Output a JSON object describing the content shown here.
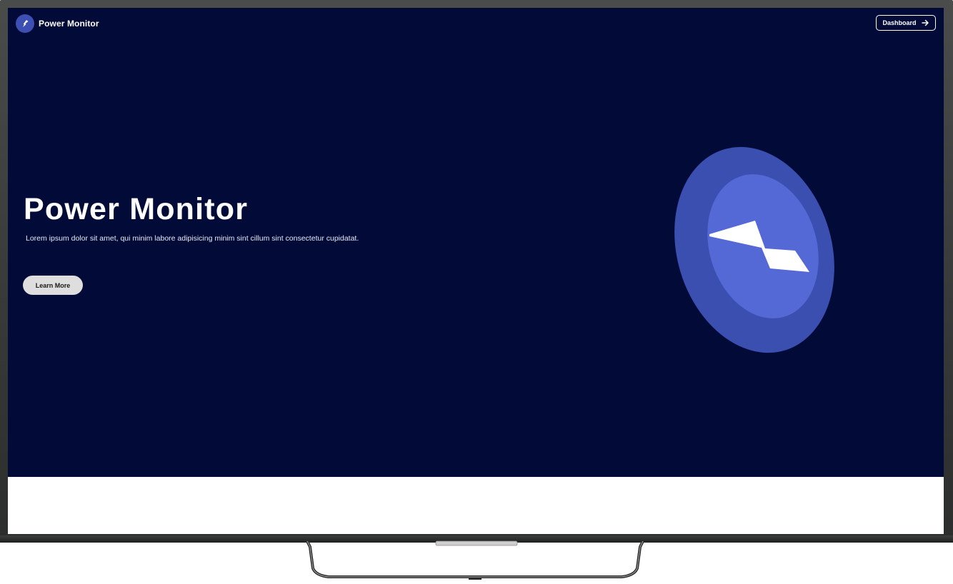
{
  "navbar": {
    "brand_name": "Power Monitor",
    "brand_icon": "bolt-icon",
    "dashboard_label": "Dashboard",
    "dashboard_icon": "arrow-right-icon"
  },
  "hero": {
    "title": "Power Monitor",
    "subtitle": "Lorem ipsum dolor sit amet, qui minim labore adipisicing minim sint cillum sint consectetur cupidatat.",
    "learn_more_label": "Learn More",
    "illustration_icon": "power-bolt-disc-icon"
  },
  "colors": {
    "background": "#020b38",
    "disc_outer": "#3a4fb0",
    "disc_inner": "#5569d6",
    "button_bg": "#dedede",
    "wave_light": "#a3a7bf",
    "frame": "#3a3c3b"
  }
}
